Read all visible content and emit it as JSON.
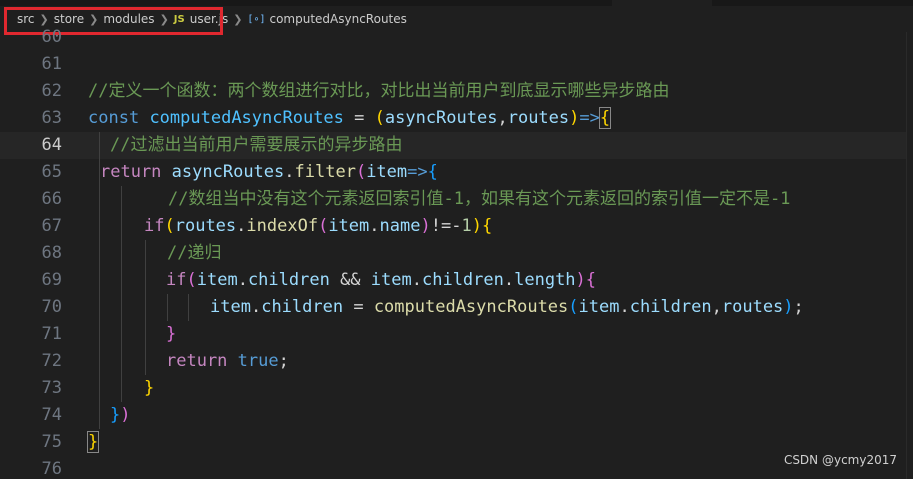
{
  "breadcrumb": {
    "items": [
      "src",
      "store",
      "modules",
      "user.js",
      "computedAsyncRoutes"
    ],
    "file_icon_label": "JS"
  },
  "gutter": {
    "line_numbers": [
      "60",
      "61",
      "62",
      "63",
      "64",
      "65",
      "66",
      "67",
      "68",
      "69",
      "70",
      "71",
      "72",
      "73",
      "74",
      "75",
      "76"
    ],
    "current_line": "64"
  },
  "code": {
    "l62_comment": "//定义一个函数：两个数组进行对比，对比出当前用户到底显示哪些异步路由",
    "l63_const": "const",
    "l63_name": "computedAsyncRoutes",
    "l63_eq": " = ",
    "l63_paren_open": "(",
    "l63_param1": "asyncRoutes",
    "l63_comma": ",",
    "l63_param2": "routes",
    "l63_paren_close": ")",
    "l63_arrow": "=>",
    "l63_brace": "{",
    "l64_comment": "//过滤出当前用户需要展示的异步路由",
    "l65_return": "return",
    "l65_obj": "asyncRoutes",
    "l65_dot": ".",
    "l65_method": "filter",
    "l65_paren": "(",
    "l65_param": "item",
    "l65_arrow": "=>",
    "l65_brace": "{",
    "l66_comment": "//数组当中没有这个元素返回索引值-1，如果有这个元素返回的索引值一定不是-1",
    "l67_if": "if",
    "l67_paren": "(",
    "l67_obj": "routes",
    "l67_dot": ".",
    "l67_method": "indexOf",
    "l67_paren2": "(",
    "l67_item": "item",
    "l67_dot2": ".",
    "l67_prop": "name",
    "l67_paren2_close": ")",
    "l67_op": "!=-",
    "l67_num": "1",
    "l67_paren_close": ")",
    "l67_brace": "{",
    "l68_comment": "//递归",
    "l69_if": "if",
    "l69_paren": "(",
    "l69_item": "item",
    "l69_dot": ".",
    "l69_prop": "children",
    "l69_and": " && ",
    "l69_item2": "item",
    "l69_dot2": ".",
    "l69_prop2": "children",
    "l69_dot3": ".",
    "l69_prop3": "length",
    "l69_paren_close": ")",
    "l69_brace": "{",
    "l70_item": "item",
    "l70_dot": ".",
    "l70_prop": "children",
    "l70_eq": " = ",
    "l70_fn": "computedAsyncRoutes",
    "l70_paren": "(",
    "l70_arg1_obj": "item",
    "l70_arg1_dot": ".",
    "l70_arg1_prop": "children",
    "l70_comma": ",",
    "l70_arg2": "routes",
    "l70_paren_close": ")",
    "l70_semi": ";",
    "l71_brace": "}",
    "l72_return": "return",
    "l72_true": "true",
    "l72_semi": ";",
    "l73_brace": "}",
    "l74_brace": "}",
    "l74_paren": ")",
    "l75_brace": "}"
  },
  "watermark": "CSDN @ycmy2017",
  "colors": {
    "editor_bg": "#1f1f1f",
    "highlight_box": "#e0282f",
    "keyword": "#569cd6",
    "control": "#c586c0",
    "variable": "#9cdcfe",
    "function": "#dcdcaa",
    "comment": "#6a9955",
    "number": "#b5cea8",
    "bracket_gold": "#ffd700",
    "bracket_orchid": "#da70d6",
    "bracket_blue": "#179fff"
  }
}
